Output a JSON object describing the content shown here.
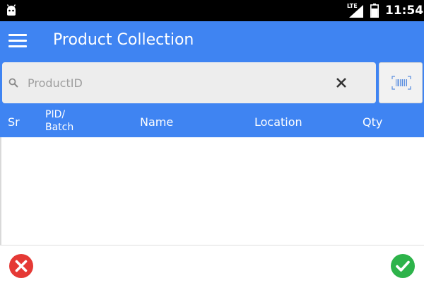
{
  "status_bar": {
    "network_label": "LTE",
    "time": "11:54",
    "icons": [
      "android-icon",
      "signal-icon",
      "battery-icon"
    ]
  },
  "app_bar": {
    "title": "Product Collection",
    "menu_icon": "hamburger-menu-icon"
  },
  "search": {
    "placeholder": "ProductID",
    "value": "",
    "search_icon": "search-icon",
    "clear_icon": "close-icon",
    "scan_icon": "barcode-icon"
  },
  "table": {
    "columns": [
      "Sr",
      "PID/ Batch",
      "Name",
      "Location",
      "Qty"
    ],
    "rows": []
  },
  "actions": {
    "cancel_icon": "cancel-icon",
    "confirm_icon": "check-icon"
  },
  "colors": {
    "primary": "#3f84f2",
    "cancel": "#e53935",
    "confirm": "#2db34a"
  }
}
